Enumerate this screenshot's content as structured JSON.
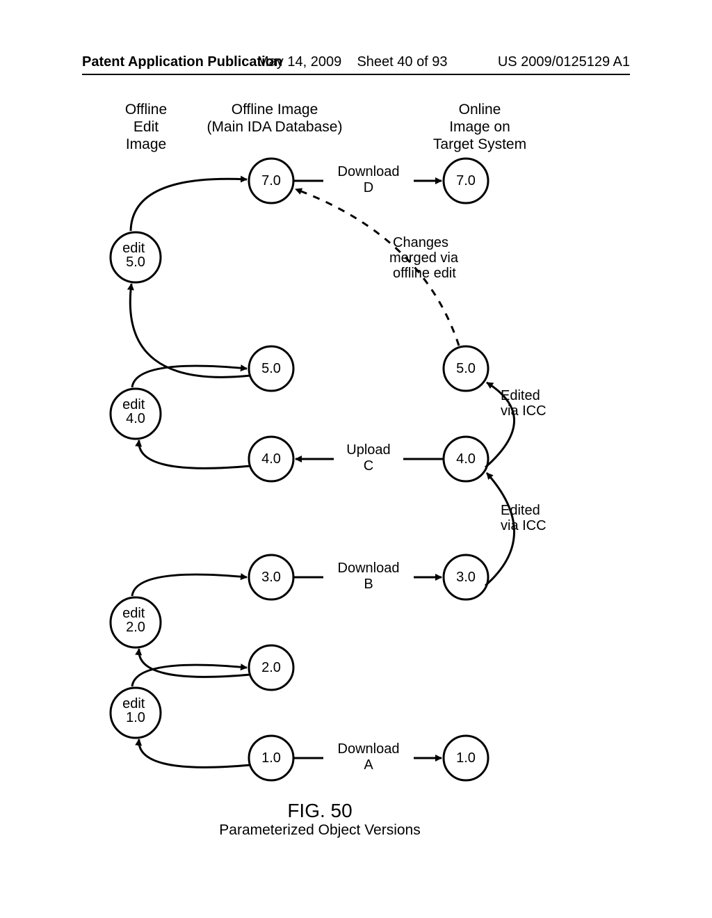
{
  "header": {
    "left": "Patent Application Publication",
    "mid_date": "May 14, 2009",
    "mid_sheet": "Sheet 40 of 93",
    "right": "US 2009/0125129 A1"
  },
  "columns": {
    "edit": "Offline\nEdit\nImage",
    "offline": "Offline Image\n(Main IDA Database)",
    "online": "Online\nImage on\nTarget System"
  },
  "nodes": {
    "offline_10": "1.0",
    "offline_20": "2.0",
    "offline_30": "3.0",
    "offline_40": "4.0",
    "offline_50": "5.0",
    "offline_70": "7.0",
    "online_10": "1.0",
    "online_30": "3.0",
    "online_40": "4.0",
    "online_50": "5.0",
    "online_70": "7.0",
    "edit_10": "edit\n1.0",
    "edit_20": "edit\n2.0",
    "edit_40": "edit\n4.0",
    "edit_50": "edit\n5.0"
  },
  "flows": {
    "a1": "Download",
    "a2": "A",
    "b1": "Download",
    "b2": "B",
    "c1": "Upload",
    "c2": "C",
    "d1": "Download",
    "d2": "D"
  },
  "annotations": {
    "merged1": "Changes",
    "merged2": "merged via",
    "merged3": "offline edit",
    "icc1": "Edited",
    "icc2": "via ICC"
  },
  "figure": {
    "num": "FIG. 50",
    "caption": "Parameterized Object Versions"
  }
}
